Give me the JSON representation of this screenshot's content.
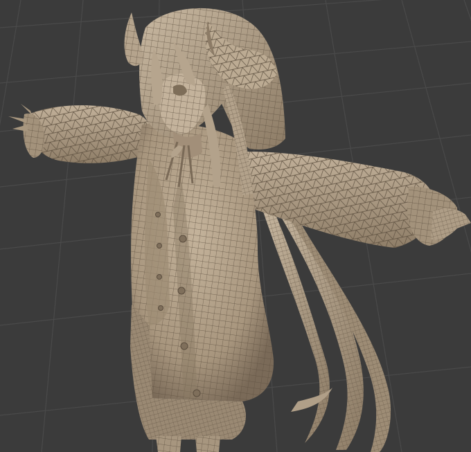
{
  "viewport": {
    "background_color": "#3b3b3b",
    "grid_color": "#4a4a4a",
    "grid_highlight_color": "#525252",
    "mesh_base_color": "#b8a790",
    "mesh_shadow_color": "#6f6252",
    "wire_color": "#5a4d3e",
    "display_mode": "wireframe-on-shaded",
    "object": {
      "name_icon": "character-mesh-icon",
      "parts": [
        "horns",
        "hair",
        "head",
        "arms",
        "cardigan",
        "skirt",
        "long-hair-strands"
      ]
    }
  }
}
